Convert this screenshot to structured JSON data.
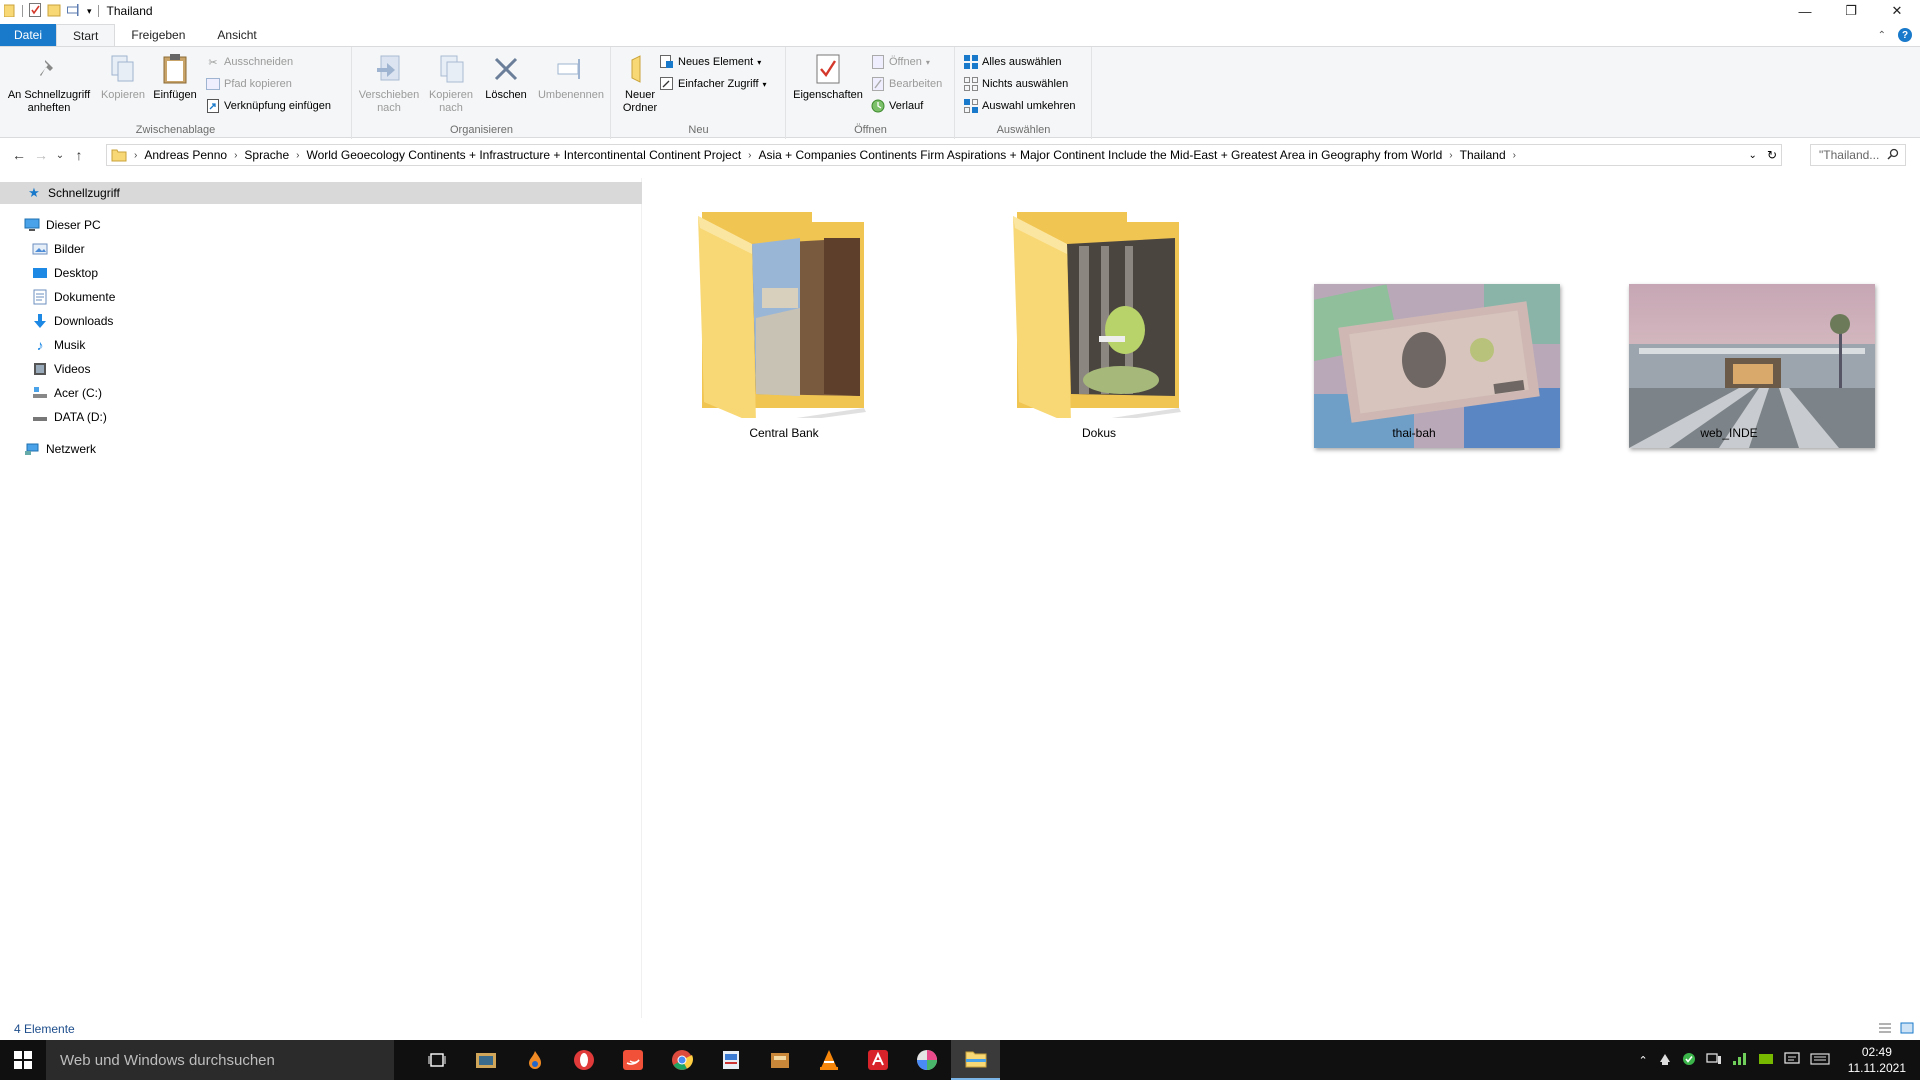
{
  "window": {
    "title": "Thailand"
  },
  "ribbon_tabs": [
    "Datei",
    "Start",
    "Freigeben",
    "Ansicht"
  ],
  "ribbon": {
    "zwischenablage": {
      "label": "Zwischenablage",
      "pin": "An Schnellzugriff anheften",
      "copy": "Kopieren",
      "paste": "Einfügen",
      "cut": "Ausschneiden",
      "copy_path": "Pfad kopieren",
      "paste_shortcut": "Verknüpfung einfügen"
    },
    "organisieren": {
      "label": "Organisieren",
      "move": "Verschieben nach",
      "copyto": "Kopieren nach",
      "delete": "Löschen",
      "rename": "Umbenennen"
    },
    "neu": {
      "label": "Neu",
      "new_folder": "Neuer Ordner",
      "new_item": "Neues Element",
      "easy_access": "Einfacher Zugriff"
    },
    "oeffnen": {
      "label": "Öffnen",
      "properties": "Eigenschaften",
      "open": "Öffnen",
      "edit": "Bearbeiten",
      "history": "Verlauf"
    },
    "auswaehlen": {
      "label": "Auswählen",
      "select_all": "Alles auswählen",
      "select_none": "Nichts auswählen",
      "invert": "Auswahl umkehren"
    }
  },
  "address": {
    "crumbs": [
      "Andreas Penno",
      "Sprache",
      "World Geoecology Continents + Infrastructure + Intercontinental Continent Project",
      "Asia + Companies  Continents Firm Aspirations + Major Continent Include the Mid-East + Greatest Area in Geography from World",
      "Thailand"
    ],
    "search_placeholder": "\"Thailand..."
  },
  "navpane": {
    "quick_access": "Schnellzugriff",
    "this_pc": "Dieser PC",
    "items": [
      "Bilder",
      "Desktop",
      "Dokumente",
      "Downloads",
      "Musik",
      "Videos",
      "Acer (C:)",
      "DATA (D:)"
    ],
    "network": "Netzwerk"
  },
  "files": [
    {
      "name": "Central Bank",
      "kind": "folder"
    },
    {
      "name": "Dokus",
      "kind": "folder"
    },
    {
      "name": "thai-bah",
      "kind": "image"
    },
    {
      "name": "web_INDE",
      "kind": "image"
    }
  ],
  "status": {
    "count": "4 Elemente"
  },
  "taskbar": {
    "search_placeholder": "Web und Windows durchsuchen",
    "time": "02:49",
    "date": "11.11.2021"
  },
  "colors": {
    "accent": "#1979ca",
    "folder": "#f8d775",
    "taskbar": "#101010"
  }
}
